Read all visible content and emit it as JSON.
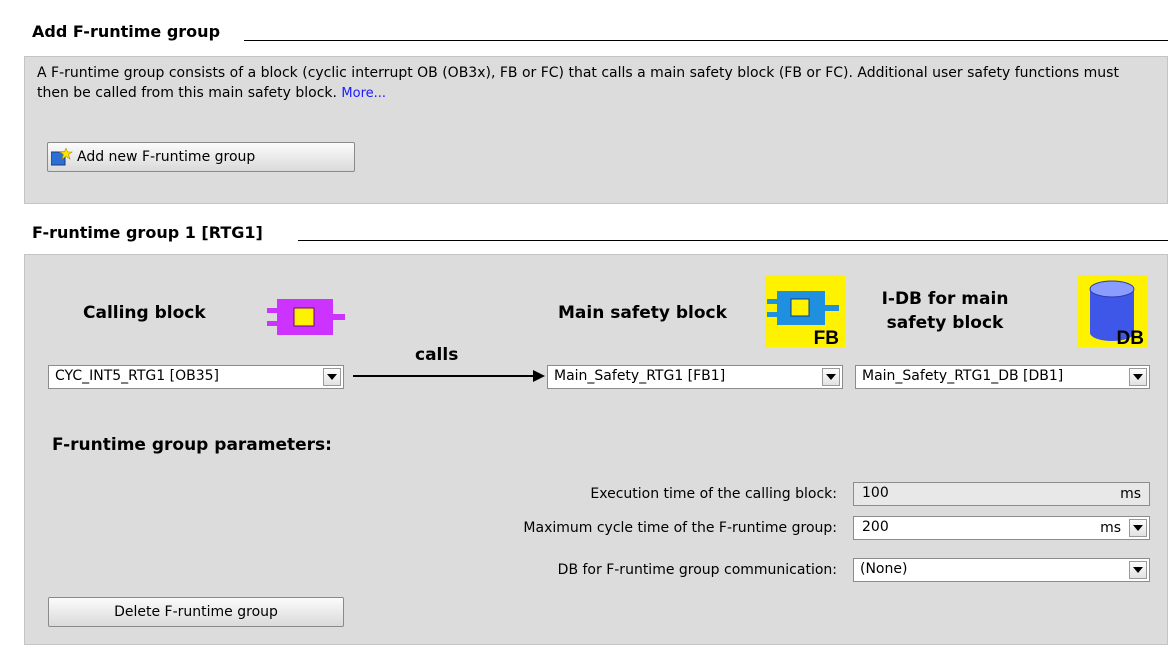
{
  "add_section": {
    "title": "Add F-runtime group",
    "description": "A F-runtime group consists of a block (cyclic interrupt OB (OB3x), FB or FC) that calls a main safety block (FB or FC). Additional user safety functions must then be called from this main safety block.",
    "more_link": "More...",
    "add_button_label": "Add new F-runtime group"
  },
  "group_section": {
    "title": "F-runtime group 1 [RTG1]",
    "calling_block": {
      "label": "Calling block",
      "value": "CYC_INT5_RTG1 [OB35]"
    },
    "calls_label": "calls",
    "main_safety_block": {
      "label": "Main safety block",
      "value": "Main_Safety_RTG1 [FB1]",
      "icon_text": "FB"
    },
    "idb": {
      "label_line1": "I-DB for main",
      "label_line2": "safety block",
      "value": "Main_Safety_RTG1_DB [DB1]",
      "icon_text": "DB"
    },
    "parameters_title": "F-runtime group parameters:",
    "parameters": [
      {
        "label": "Execution time of the calling block:",
        "value": "100",
        "unit": "ms"
      },
      {
        "label": "Maximum cycle time of the F-runtime group:",
        "value": "200",
        "unit": "ms"
      },
      {
        "label": "DB for F-runtime group communication:",
        "value": "(None)"
      }
    ],
    "delete_button_label": "Delete F-runtime group"
  },
  "colors": {
    "panel_bg": "#dcdcdc",
    "icon_highlight": "#fff200",
    "block_icon_purple": "#cc33ff",
    "block_icon_blue": "#1f8fe0",
    "db_icon_blue": "#3f57e8",
    "link_blue": "#1a1aff"
  }
}
